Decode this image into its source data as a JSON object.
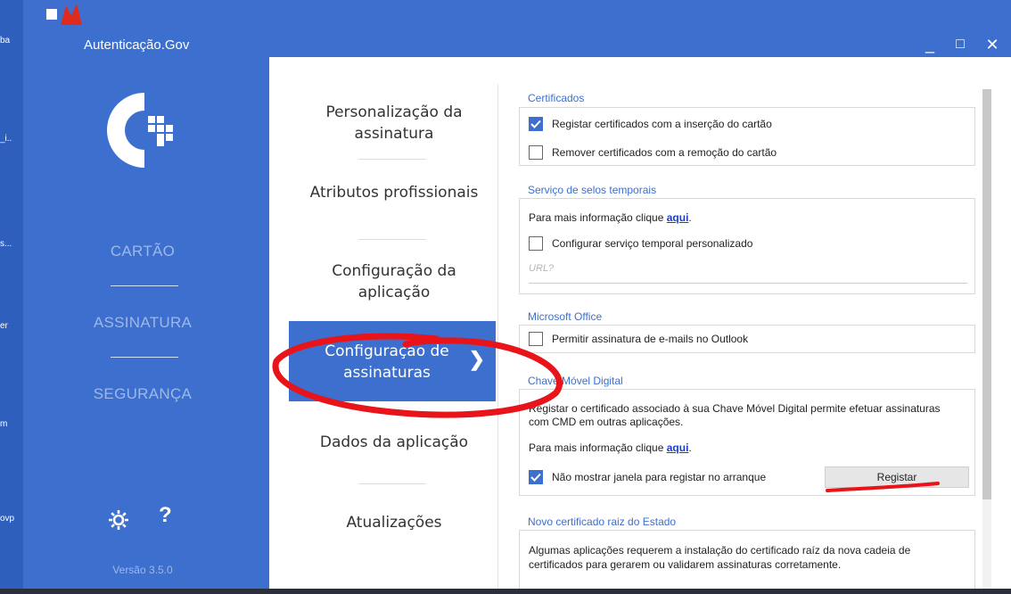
{
  "desktop": {
    "labels": [
      "ba",
      "_i..",
      "s...",
      "er",
      "m",
      "ovp"
    ]
  },
  "window": {
    "title": "Autenticação.Gov",
    "minimize": "_",
    "maximize": "□",
    "close": "✕"
  },
  "nav": {
    "items": [
      {
        "label": "CARTÃO"
      },
      {
        "label": "ASSINATURA"
      },
      {
        "label": "SEGURANÇA"
      }
    ],
    "help": "?",
    "version": "Versão 3.5.0"
  },
  "submenu": {
    "items": [
      {
        "label": "Personalização da assinatura"
      },
      {
        "label": "Atributos profissionais"
      },
      {
        "label": "Configuração da aplicação"
      },
      {
        "label": "Configuração de assinaturas",
        "active": true
      },
      {
        "label": "Dados da aplicação"
      },
      {
        "label": "Atualizações"
      }
    ]
  },
  "panel": {
    "certificados": {
      "title": "Certificados",
      "opt1": {
        "label": "Registar certificados com a inserção do cartão",
        "checked": true
      },
      "opt2": {
        "label": "Remover certificados com a remoção do cartão",
        "checked": false
      }
    },
    "selos": {
      "title": "Serviço de selos temporais",
      "info": "Para mais informação clique",
      "link": "aqui",
      "opt1": {
        "label": "Configurar serviço temporal personalizado",
        "checked": false
      },
      "url_placeholder": "URL?"
    },
    "office": {
      "title": "Microsoft Office",
      "opt1": {
        "label": "Permitir assinatura de e-mails no Outlook",
        "checked": false
      }
    },
    "cmd": {
      "title": "Chave Móvel Digital",
      "desc_line1": "Registar o certificado associado à sua Chave Móvel Digital permite efetuar assinaturas",
      "desc_line2": "com CMD em outras aplicações.",
      "info": "Para mais informação clique",
      "link": "aqui",
      "opt1": {
        "label": "Não mostrar janela para registar no arranque",
        "checked": true
      },
      "button": "Registar"
    },
    "raiz": {
      "title": "Novo certificado raiz do Estado",
      "desc_line1": "Algumas aplicações requerem a instalação do certificado raíz da nova cadeia de",
      "desc_line2": "certificados para gerarem ou validarem assinaturas corretamente."
    }
  },
  "colors": {
    "brand_blue": "#3c6fce",
    "annotation_red": "#e8141a"
  }
}
